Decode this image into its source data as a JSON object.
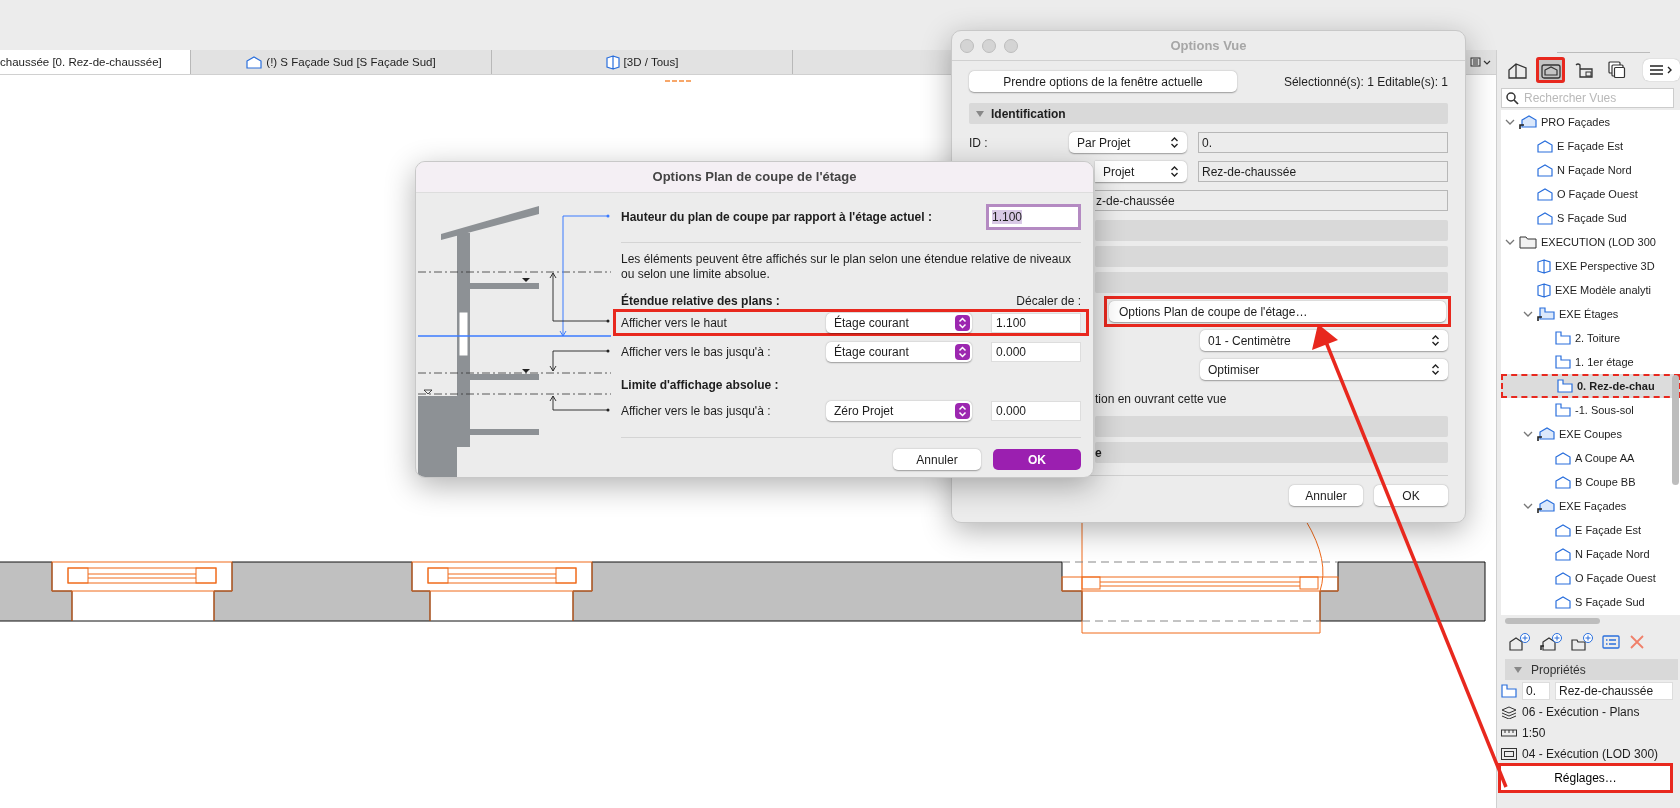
{
  "top_tabs": [
    {
      "label": "chaussée [0. Rez-de-chaussée]",
      "kind": "plan",
      "selected": true
    },
    {
      "label": "(!) S Façade Sud [S Façade Sud]",
      "kind": "elevation",
      "selected": false
    },
    {
      "label": "[3D / Tous]",
      "kind": "perspective",
      "selected": false
    }
  ],
  "options_vue": {
    "title": "Options Vue",
    "take_button": "Prendre options de la fenêtre actuelle",
    "selection_info": "Sélectionné(s): 1 Editable(s): 1",
    "section": {
      "title": "Identification",
      "expanded": true
    },
    "id_label": "ID :",
    "id_source": "Par Projet",
    "id_value": "0.",
    "name_source": "Projet",
    "name_value": "Rez-de-chaussée",
    "ref_value": "z-de-chaussée",
    "cut_plane_button": {
      "label": "Options Plan de coupe de l'étage…",
      "highlighted": true
    },
    "unit_select": "01 - Centimètre",
    "mode_select": "Optimiser",
    "partial_option": "tion en ouvrant cette vue",
    "partial_header": "e",
    "cancel": "Annuler",
    "ok": "OK"
  },
  "cut_plane_dialog": {
    "title": "Options Plan de coupe de l'étage",
    "height_label": "Hauteur du plan de coupe par rapport à l'étage actuel :",
    "height_field": {
      "value": "1.100",
      "focused": true,
      "text_selected": true
    },
    "description": "Les éléments peuvent être affichés sur le plan selon une étendue relative de niveaux ou selon une limite absolue.",
    "relative_title": "Étendue relative des plans :",
    "offset_header": "Décaler de :",
    "relative_rows": [
      {
        "label": "Afficher vers le haut",
        "select": "Étage courant",
        "value": "1.100",
        "highlighted": true
      },
      {
        "label": "Afficher vers le bas jusqu'à :",
        "select": "Étage courant",
        "value": "0.000",
        "highlighted": false
      }
    ],
    "absolute_title": "Limite d'affichage absolue :",
    "absolute_rows": [
      {
        "label": "Afficher vers le bas jusqu'à :",
        "select": "Zéro Projet",
        "value": "0.000",
        "highlighted": false
      }
    ],
    "cancel": "Annuler",
    "ok": "OK"
  },
  "navigator": {
    "toolbar": [
      {
        "kind": "house",
        "selected": false,
        "highlighted": false
      },
      {
        "kind": "view-map",
        "selected": true,
        "highlighted": true
      },
      {
        "kind": "layout",
        "selected": false,
        "highlighted": false
      },
      {
        "kind": "stack",
        "selected": false,
        "highlighted": false
      }
    ],
    "search": {
      "placeholder": "Rechercher Vues"
    },
    "tree": [
      {
        "label": "PRO Façades",
        "kind": "elevation-group",
        "expanded": true,
        "selected": false,
        "highlighted": false,
        "children": [
          {
            "label": "E Façade Est",
            "kind": "elevation",
            "selected": false,
            "highlighted": false
          },
          {
            "label": "N Façade Nord",
            "kind": "elevation",
            "selected": false,
            "highlighted": false
          },
          {
            "label": "O Façade Ouest",
            "kind": "elevation",
            "selected": false,
            "highlighted": false
          },
          {
            "label": "S Façade Sud",
            "kind": "elevation",
            "selected": false,
            "highlighted": false
          }
        ]
      },
      {
        "label": "EXECUTION (LOD 300",
        "kind": "folder",
        "expanded": true,
        "selected": false,
        "highlighted": false,
        "children": [
          {
            "label": "EXE Perspective 3D",
            "kind": "perspective",
            "selected": false,
            "highlighted": false
          },
          {
            "label": "EXE Modèle analyti",
            "kind": "perspective",
            "selected": false,
            "highlighted": false
          },
          {
            "label": "EXE Étages",
            "kind": "plan-group",
            "expanded": true,
            "selected": false,
            "highlighted": false,
            "children": [
              {
                "label": "2. Toiture",
                "kind": "plan",
                "selected": false,
                "highlighted": false
              },
              {
                "label": "1. 1er étage",
                "kind": "plan",
                "selected": false,
                "highlighted": false
              },
              {
                "label": "0. Rez-de-chau",
                "kind": "plan",
                "selected": true,
                "highlighted": true
              },
              {
                "label": "-1. Sous-sol",
                "kind": "plan",
                "selected": false,
                "highlighted": false
              }
            ]
          },
          {
            "label": "EXE Coupes",
            "kind": "elevation-group",
            "expanded": true,
            "selected": false,
            "highlighted": false,
            "children": [
              {
                "label": "A Coupe AA",
                "kind": "elevation",
                "selected": false,
                "highlighted": false
              },
              {
                "label": "B Coupe BB",
                "kind": "elevation",
                "selected": false,
                "highlighted": false
              }
            ]
          },
          {
            "label": "EXE Façades",
            "kind": "elevation-group",
            "expanded": true,
            "selected": false,
            "highlighted": false,
            "children": [
              {
                "label": "E Façade Est",
                "kind": "elevation",
                "selected": false,
                "highlighted": false
              },
              {
                "label": "N Façade Nord",
                "kind": "elevation",
                "selected": false,
                "highlighted": false
              },
              {
                "label": "O Façade Ouest",
                "kind": "elevation",
                "selected": false,
                "highlighted": false
              },
              {
                "label": "S Façade Sud",
                "kind": "elevation",
                "selected": false,
                "highlighted": false
              }
            ]
          }
        ]
      }
    ]
  },
  "properties": {
    "title": "Propriétés",
    "expanded": true,
    "id": "0.",
    "name": "Rez-de-chaussée",
    "layer_combination": "06 - Exécution - Plans",
    "scale": "1:50",
    "model_view": "04 - Exécution (LOD 300)",
    "settings_button": {
      "label": "Réglages…",
      "highlighted": true
    }
  }
}
